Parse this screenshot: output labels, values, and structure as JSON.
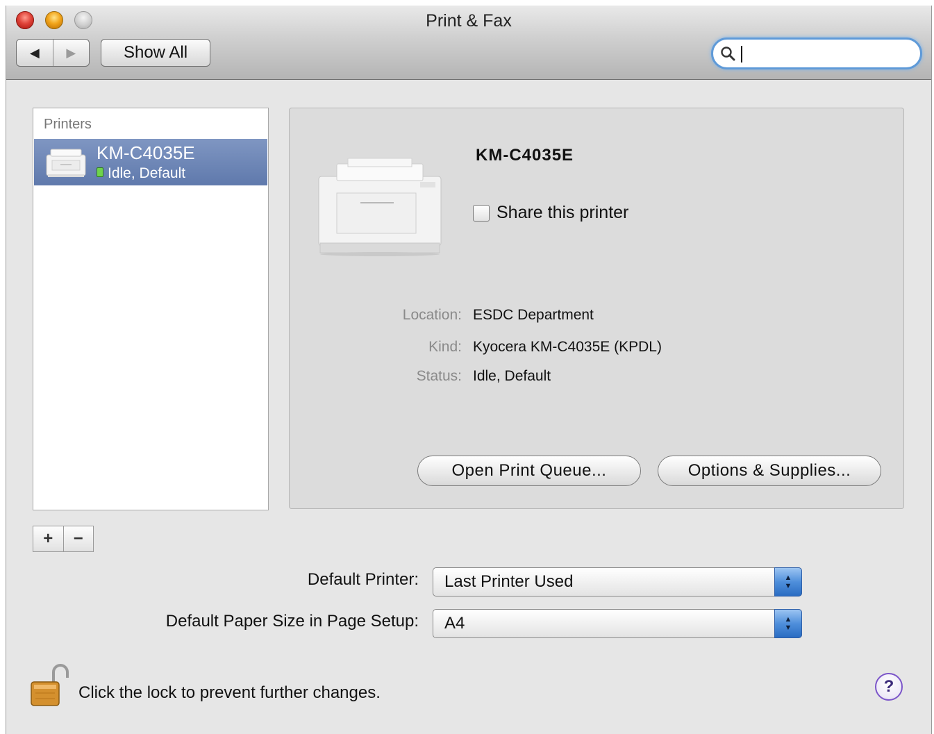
{
  "window": {
    "title": "Print & Fax",
    "show_all_label": "Show All",
    "back_glyph": "◀",
    "forward_glyph": "▶",
    "search": {
      "value": "",
      "placeholder": ""
    }
  },
  "printers_list": {
    "header": "Printers",
    "items": [
      {
        "name": "KM-C4035E",
        "status": "Idle, Default",
        "icon": "printer-icon",
        "selected": true
      }
    ],
    "add_glyph": "+",
    "remove_glyph": "−"
  },
  "details": {
    "name": "KM-C4035E",
    "share_label": "Share this printer",
    "share_checked": false,
    "location_label": "Location:",
    "location_value": "ESDC Department",
    "kind_label": "Kind:",
    "kind_value": "Kyocera KM-C4035E (KPDL)",
    "status_label": "Status:",
    "status_value": "Idle, Default",
    "open_queue_label": "Open Print Queue...",
    "options_label": "Options & Supplies..."
  },
  "defaults": {
    "default_printer_label": "Default Printer:",
    "default_printer_value": "Last Printer Used",
    "paper_size_label": "Default Paper Size in Page Setup:",
    "paper_size_value": "A4"
  },
  "footer": {
    "lock_text": "Click the lock to prevent further changes.",
    "help_glyph": "?"
  },
  "colors": {
    "selection": "#6b84b7",
    "search_focus": "#5f9ad8",
    "popup_stepper": "#4f8fdb",
    "status_green": "#6fd34c"
  }
}
